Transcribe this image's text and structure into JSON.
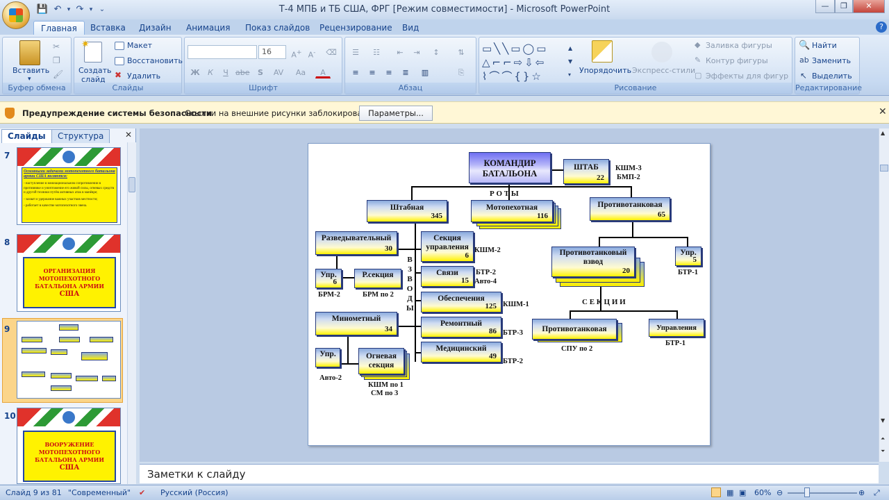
{
  "window": {
    "title": "Т-4 МПБ и ТБ США, ФРГ [Режим совместимости] - Microsoft PowerPoint"
  },
  "tabs": [
    "Главная",
    "Вставка",
    "Дизайн",
    "Анимация",
    "Показ слайдов",
    "Рецензирование",
    "Вид"
  ],
  "ribbon": {
    "clipboard": {
      "label": "Буфер обмена",
      "paste": "Вставить"
    },
    "slides": {
      "label": "Слайды",
      "create": "Создать",
      "create2": "слайд",
      "layout": "Макет",
      "reset": "Восстановить",
      "delete": "Удалить"
    },
    "font": {
      "label": "Шрифт",
      "size": "16",
      "bold": "Ж",
      "italic": "К",
      "underline": "Ч",
      "strike": "abe",
      "shadow": "S",
      "spacing": "AV",
      "case": "Aa",
      "color": "A"
    },
    "paragraph": {
      "label": "Абзац"
    },
    "drawing": {
      "label": "Рисование",
      "arrange": "Упорядочить",
      "quickstyles": "Экспресс-стили",
      "fill": "Заливка фигуры",
      "outline": "Контур фигуры",
      "effects": "Эффекты для фигур"
    },
    "editing": {
      "label": "Редактирование",
      "find": "Найти",
      "replace": "Заменить",
      "select": "Выделить"
    }
  },
  "security": {
    "title": "Предупреждение системы безопасности",
    "message": "Ссылки на внешние рисунки заблокированы",
    "button": "Параметры..."
  },
  "panel": {
    "tab_slides": "Слайды",
    "tab_outline": "Структура"
  },
  "thumbnails": [
    {
      "num": "7",
      "title": "Основными задачами мотопехотного батальона армии США являются:",
      "bullets": [
        "- наступление в межнациональном сопротивлении в противнике и уничтожение его живой силы, огневых средств и другой техники путём активных атак в манёвре;",
        "- захват и удержание важных участков местности;",
        "- работает в качестве мотопехотного звена."
      ]
    },
    {
      "num": "8",
      "line1": "ОРГАНИЗАЦИЯ",
      "line2": "МОТОПЕХОТНОГО",
      "line3": "БАТАЛЬОНА АРМИИ",
      "line4": "США"
    },
    {
      "num": "9"
    },
    {
      "num": "10",
      "line1": "ВООРУЖЕНИЕ",
      "line2": "МОТОПЕХОТНОГО",
      "line3": "БАТАЛЬОНА АРМИИ",
      "line4": "США"
    }
  ],
  "slide": {
    "commander": "КОМАНДИР БАТАЛЬОНА",
    "hq": {
      "title": "ШТАБ",
      "num": "22",
      "note1": "КШМ-3",
      "note2": "БМП-2"
    },
    "roty": "Р О Т Ы",
    "shtab": {
      "title": "Штабная",
      "num": "345"
    },
    "moto": {
      "title": "Мотопехотная",
      "num": "116"
    },
    "pt": {
      "title": "Противотанковая",
      "num": "65"
    },
    "razv": {
      "title": "Разведывательный",
      "num": "30"
    },
    "razv_upr": {
      "title": "Упр.",
      "num": "6",
      "note": "БРМ-2"
    },
    "rsek": {
      "title": "Р.секция",
      "note": "БРМ по 2"
    },
    "vzvody": "В З В О Д Ы",
    "sek_upr": {
      "title": "Секция управления",
      "num": "6",
      "note": "КШМ-2"
    },
    "svyaz": {
      "title": "Связи",
      "num": "15",
      "note1": "БТР-2",
      "note2": "Авто-4"
    },
    "obesp": {
      "title": "Обеспечения",
      "num": "125",
      "note": "КШМ-1"
    },
    "remont": {
      "title": "Ремонтный",
      "num": "86",
      "note": "БТР-3"
    },
    "med": {
      "title": "Медицинский",
      "num": "49",
      "note": "БТР-2"
    },
    "minom": {
      "title": "Минометный",
      "num": "34"
    },
    "min_upr": {
      "title": "Упр.",
      "note": "Авто-2"
    },
    "ogn": {
      "title": "Огневая секция",
      "note1": "КШМ по 1",
      "note2": "СМ по 3"
    },
    "ptv": {
      "title": "Противотанковый взвод",
      "num": "20"
    },
    "pt_upr": {
      "title": "Упр.",
      "num": "5",
      "note": "БТР-1"
    },
    "sektsii": "С Е К Ц И И",
    "pt_sek": {
      "title": "Противотанковая",
      "note": "СПУ по 2"
    },
    "upr_sek": {
      "title": "Управления",
      "note": "БТР-1"
    }
  },
  "notes": "Заметки к слайду",
  "status": {
    "slide": "Слайд 9 из 81",
    "theme": "\"Современный\"",
    "lang": "Русский (Россия)",
    "zoom": "60%"
  }
}
